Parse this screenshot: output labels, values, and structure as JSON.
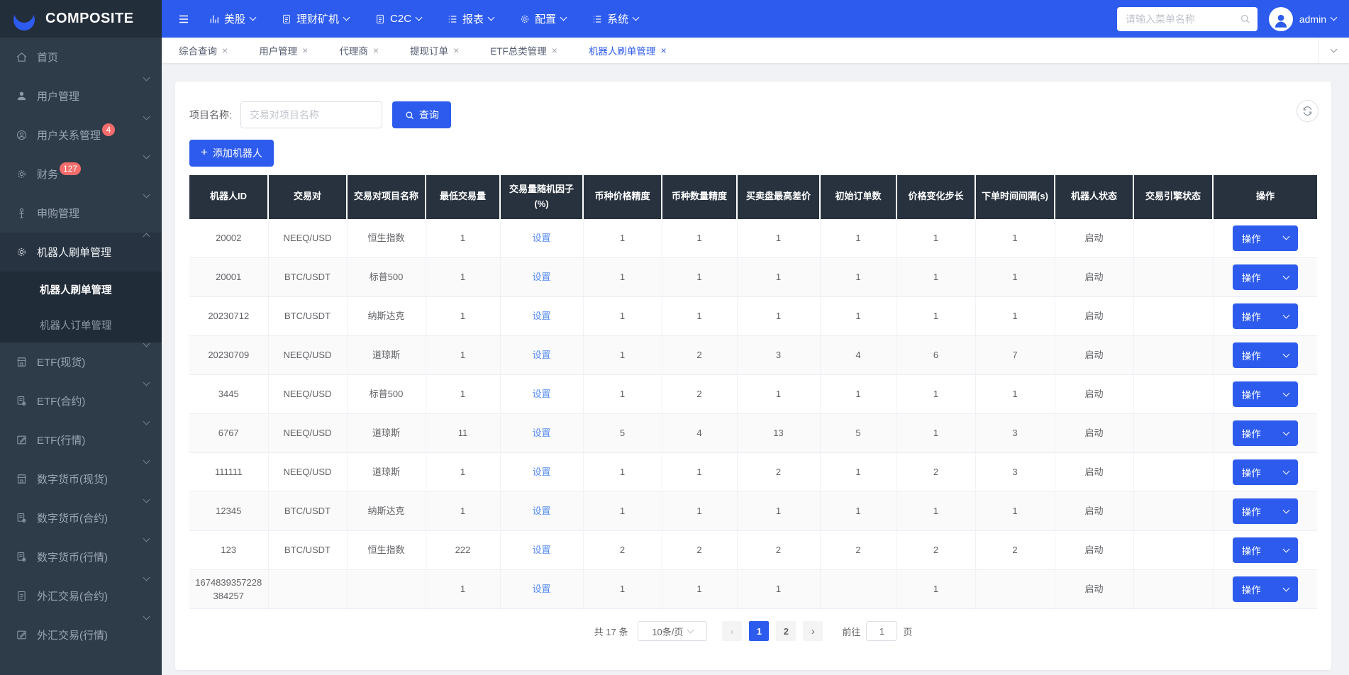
{
  "colors": {
    "accent": "#2d5bee",
    "link": "#5b8ff2",
    "badge": "#f56c6c",
    "table_header_bg": "#28323e"
  },
  "header": {
    "brand": "COMPOSITE",
    "nav": [
      {
        "label": "美股",
        "icon": "bar-chart-icon"
      },
      {
        "label": "理财矿机",
        "icon": "doc-icon"
      },
      {
        "label": "C2C",
        "icon": "doc-icon"
      },
      {
        "label": "报表",
        "icon": "list-icon"
      },
      {
        "label": "配置",
        "icon": "gear-icon"
      },
      {
        "label": "系统",
        "icon": "list-icon"
      }
    ],
    "search_placeholder": "请输入菜单名称",
    "user": "admin"
  },
  "tabs": [
    {
      "label": "综合查询",
      "active": false
    },
    {
      "label": "用户管理",
      "active": false
    },
    {
      "label": "代理商",
      "active": false
    },
    {
      "label": "提现订单",
      "active": false
    },
    {
      "label": "ETF总类管理",
      "active": false
    },
    {
      "label": "机器人刷单管理",
      "active": true
    }
  ],
  "sidebar": {
    "items": [
      {
        "label": "首页",
        "icon": "home-icon",
        "chevron": false
      },
      {
        "label": "用户管理",
        "icon": "user-icon",
        "chevron": true
      },
      {
        "label": "用户关系管理",
        "icon": "user-circle-icon",
        "badge": "4",
        "chevron": true
      },
      {
        "label": "财务",
        "icon": "gear-icon",
        "badge": "127",
        "chevron": true
      },
      {
        "label": "申购管理",
        "icon": "subscribe-icon",
        "chevron": true
      },
      {
        "label": "机器人刷单管理",
        "icon": "robot-gear-icon",
        "chevron": true,
        "open": true,
        "children": [
          {
            "label": "机器人刷单管理",
            "active": true
          },
          {
            "label": "机器人订单管理",
            "active": false
          }
        ]
      },
      {
        "label": "ETF(现货)",
        "icon": "store-icon",
        "chevron": true
      },
      {
        "label": "ETF(合约)",
        "icon": "doc-gear-icon",
        "chevron": true
      },
      {
        "label": "ETF(行情)",
        "icon": "edit-icon",
        "chevron": true
      },
      {
        "label": "数字货币(现货)",
        "icon": "store-icon",
        "chevron": true
      },
      {
        "label": "数字货币(合约)",
        "icon": "doc-gear-icon",
        "chevron": true
      },
      {
        "label": "数字货币(行情)",
        "icon": "doc-gear-icon",
        "chevron": true
      },
      {
        "label": "外汇交易(合约)",
        "icon": "doc-icon",
        "chevron": true
      },
      {
        "label": "外汇交易(行情)",
        "icon": "edit-icon",
        "chevron": true
      }
    ]
  },
  "toolbar": {
    "filter_label": "项目名称:",
    "filter_placeholder": "交易对项目名称",
    "search_label": "查询",
    "add_icon_glyph": "+",
    "add_label": "添加机器人"
  },
  "table": {
    "action_label": "操作",
    "columns": [
      {
        "key": "id",
        "label": "机器人ID"
      },
      {
        "key": "pair",
        "label": "交易对"
      },
      {
        "key": "project",
        "label": "交易对项目名称"
      },
      {
        "key": "min_volume",
        "label": "最低交易量"
      },
      {
        "key": "random_factor",
        "label": "交易量随机因子(%)"
      },
      {
        "key": "price_precision",
        "label": "币种价格精度"
      },
      {
        "key": "qty_precision",
        "label": "币种数量精度"
      },
      {
        "key": "max_spread",
        "label": "买卖盘最高差价"
      },
      {
        "key": "init_orders",
        "label": "初始订单数"
      },
      {
        "key": "price_step",
        "label": "价格变化步长"
      },
      {
        "key": "interval",
        "label": "下单时间间隔(s)"
      },
      {
        "key": "robot_status",
        "label": "机器人状态"
      },
      {
        "key": "engine_status",
        "label": "交易引擎状态"
      },
      {
        "key": "action",
        "label": "操作"
      }
    ],
    "rows": [
      {
        "id": "20002",
        "pair": "NEEQ/USD",
        "project": "恒生指数",
        "min_volume": "1",
        "random_factor": "设置",
        "price_precision": "1",
        "qty_precision": "1",
        "max_spread": "1",
        "init_orders": "1",
        "price_step": "1",
        "interval": "1",
        "robot_status": "启动",
        "engine_status": ""
      },
      {
        "id": "20001",
        "pair": "BTC/USDT",
        "project": "标普500",
        "min_volume": "1",
        "random_factor": "设置",
        "price_precision": "1",
        "qty_precision": "1",
        "max_spread": "1",
        "init_orders": "1",
        "price_step": "1",
        "interval": "1",
        "robot_status": "启动",
        "engine_status": ""
      },
      {
        "id": "20230712",
        "pair": "BTC/USDT",
        "project": "纳斯达克",
        "min_volume": "1",
        "random_factor": "设置",
        "price_precision": "1",
        "qty_precision": "1",
        "max_spread": "1",
        "init_orders": "1",
        "price_step": "1",
        "interval": "1",
        "robot_status": "启动",
        "engine_status": ""
      },
      {
        "id": "20230709",
        "pair": "NEEQ/USD",
        "project": "道琼斯",
        "min_volume": "1",
        "random_factor": "设置",
        "price_precision": "1",
        "qty_precision": "2",
        "max_spread": "3",
        "init_orders": "4",
        "price_step": "6",
        "interval": "7",
        "robot_status": "启动",
        "engine_status": ""
      },
      {
        "id": "3445",
        "pair": "NEEQ/USD",
        "project": "标普500",
        "min_volume": "1",
        "random_factor": "设置",
        "price_precision": "1",
        "qty_precision": "2",
        "max_spread": "1",
        "init_orders": "1",
        "price_step": "1",
        "interval": "1",
        "robot_status": "启动",
        "engine_status": ""
      },
      {
        "id": "6767",
        "pair": "NEEQ/USD",
        "project": "道琼斯",
        "min_volume": "11",
        "random_factor": "设置",
        "price_precision": "5",
        "qty_precision": "4",
        "max_spread": "13",
        "init_orders": "5",
        "price_step": "1",
        "interval": "3",
        "robot_status": "启动",
        "engine_status": ""
      },
      {
        "id": "111111",
        "pair": "NEEQ/USD",
        "project": "道琼斯",
        "min_volume": "1",
        "random_factor": "设置",
        "price_precision": "1",
        "qty_precision": "1",
        "max_spread": "2",
        "init_orders": "1",
        "price_step": "2",
        "interval": "3",
        "robot_status": "启动",
        "engine_status": ""
      },
      {
        "id": "12345",
        "pair": "BTC/USDT",
        "project": "纳斯达克",
        "min_volume": "1",
        "random_factor": "设置",
        "price_precision": "1",
        "qty_precision": "1",
        "max_spread": "1",
        "init_orders": "1",
        "price_step": "1",
        "interval": "1",
        "robot_status": "启动",
        "engine_status": ""
      },
      {
        "id": "123",
        "pair": "BTC/USDT",
        "project": "恒生指数",
        "min_volume": "222",
        "random_factor": "设置",
        "price_precision": "2",
        "qty_precision": "2",
        "max_spread": "2",
        "init_orders": "2",
        "price_step": "2",
        "interval": "2",
        "robot_status": "启动",
        "engine_status": ""
      },
      {
        "id": "1674839357228384257",
        "pair": "",
        "project": "",
        "min_volume": "1",
        "random_factor": "设置",
        "price_precision": "1",
        "qty_precision": "1",
        "max_spread": "1",
        "init_orders": "",
        "price_step": "1",
        "interval": "",
        "robot_status": "启动",
        "engine_status": ""
      }
    ]
  },
  "pagination": {
    "total": "共 17 条",
    "page_size": "10条/页",
    "prev_icon": "‹",
    "next_icon": "›",
    "pages": [
      "1",
      "2"
    ],
    "current": "1",
    "goto_label": "前往",
    "goto_value": "1",
    "goto_unit": "页"
  }
}
